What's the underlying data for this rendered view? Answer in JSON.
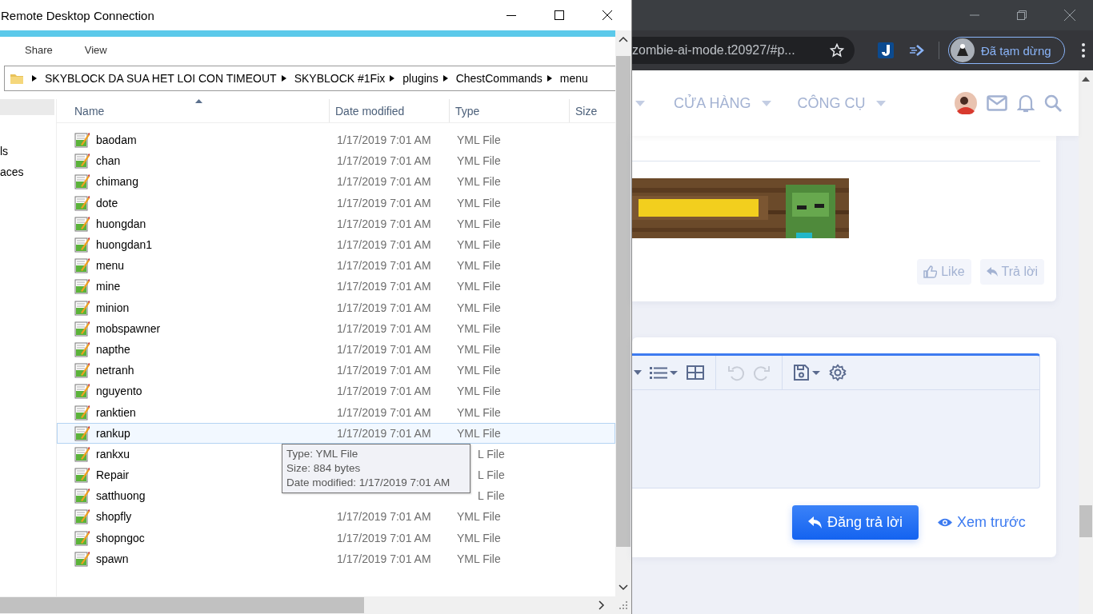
{
  "rdp_window": {
    "title": "Remote Desktop Connection"
  },
  "explorer": {
    "ribbon_tabs": [
      {
        "label": "Share"
      },
      {
        "label": "View"
      }
    ],
    "path": [
      "SKYBLOCK DA SUA HET LOI CON TIMEOUT",
      "SKYBLOCK #1Fix",
      "plugins",
      "ChestCommands",
      "menu"
    ],
    "nav_items": [
      "ls",
      "aces"
    ],
    "columns": [
      "Name",
      "Date modified",
      "Type",
      "Size"
    ],
    "rows": [
      {
        "name": "baodam",
        "date": "1/17/2019 7:01 AM",
        "type": "YML File",
        "selected": false
      },
      {
        "name": "chan",
        "date": "1/17/2019 7:01 AM",
        "type": "YML File",
        "selected": false
      },
      {
        "name": "chimang",
        "date": "1/17/2019 7:01 AM",
        "type": "YML File",
        "selected": false
      },
      {
        "name": "dote",
        "date": "1/17/2019 7:01 AM",
        "type": "YML File",
        "selected": false
      },
      {
        "name": "huongdan",
        "date": "1/17/2019 7:01 AM",
        "type": "YML File",
        "selected": false
      },
      {
        "name": "huongdan1",
        "date": "1/17/2019 7:01 AM",
        "type": "YML File",
        "selected": false
      },
      {
        "name": "menu",
        "date": "1/17/2019 7:01 AM",
        "type": "YML File",
        "selected": false
      },
      {
        "name": "mine",
        "date": "1/17/2019 7:01 AM",
        "type": "YML File",
        "selected": false
      },
      {
        "name": "minion",
        "date": "1/17/2019 7:01 AM",
        "type": "YML File",
        "selected": false
      },
      {
        "name": "mobspawner",
        "date": "1/17/2019 7:01 AM",
        "type": "YML File",
        "selected": false
      },
      {
        "name": "napthe",
        "date": "1/17/2019 7:01 AM",
        "type": "YML File",
        "selected": false
      },
      {
        "name": "netranh",
        "date": "1/17/2019 7:01 AM",
        "type": "YML File",
        "selected": false
      },
      {
        "name": "nguyento",
        "date": "1/17/2019 7:01 AM",
        "type": "YML File",
        "selected": false
      },
      {
        "name": "ranktien",
        "date": "1/17/2019 7:01 AM",
        "type": "YML File",
        "selected": false
      },
      {
        "name": "rankup",
        "date": "1/17/2019 7:01 AM",
        "type": "YML File",
        "selected": true
      },
      {
        "name": "rankxu",
        "type": "L File",
        "selected": false
      },
      {
        "name": "Repair",
        "type": "L File",
        "selected": false
      },
      {
        "name": "satthuong",
        "type": "L File",
        "selected": false
      },
      {
        "name": "shopfly",
        "date": "1/17/2019 7:01 AM",
        "type": "YML File",
        "selected": false
      },
      {
        "name": "shopngoc",
        "date": "1/17/2019 7:01 AM",
        "type": "YML File",
        "selected": false
      },
      {
        "name": "spawn",
        "date": "1/17/2019 7:01 AM",
        "type": "YML File",
        "selected": false
      }
    ],
    "tooltip": [
      "Type: YML File",
      "Size: 884 bytes",
      "Date modified: 1/17/2019 7:01 AM"
    ]
  },
  "browser": {
    "url": "zombie-ai-mode.t20927/#p...",
    "profile": "Đã tạm dừng",
    "nav": [
      {
        "label": "CỬA HÀNG"
      },
      {
        "label": "CÔNG CỤ"
      }
    ],
    "post_actions": [
      "Like",
      "Trả lời"
    ],
    "reply": {
      "submit": "Đăng trả lời",
      "preview": "Xem trước"
    }
  }
}
